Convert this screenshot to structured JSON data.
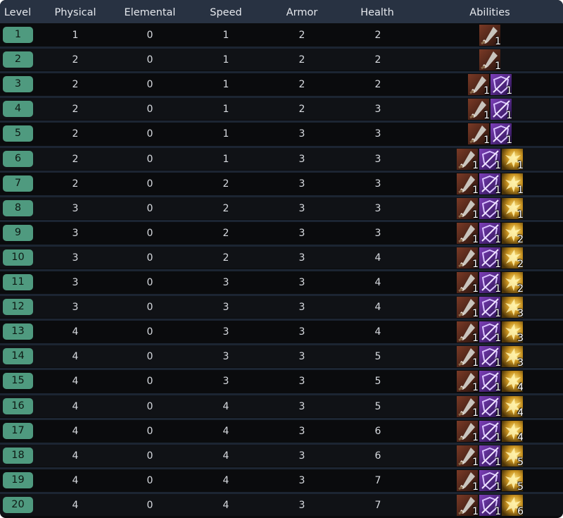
{
  "headers": {
    "level": "Level",
    "physical": "Physical",
    "elemental": "Elemental",
    "speed": "Speed",
    "armor": "Armor",
    "health": "Health",
    "abilities": "Abilities"
  },
  "ability_icons": [
    "blade-strike-icon",
    "arcane-shield-icon",
    "golden-burst-icon"
  ],
  "colors": {
    "level_badge": "#4f9a7f",
    "header_bg": "#283242",
    "ability_1": "#5a2e20",
    "ability_2": "#5b2a8a",
    "ability_3": "#b88a1a"
  },
  "rows": [
    {
      "level": "1",
      "physical": "1",
      "elemental": "0",
      "speed": "1",
      "armor": "2",
      "health": "2",
      "abilities": [
        "1"
      ]
    },
    {
      "level": "2",
      "physical": "2",
      "elemental": "0",
      "speed": "1",
      "armor": "2",
      "health": "2",
      "abilities": [
        "1"
      ]
    },
    {
      "level": "3",
      "physical": "2",
      "elemental": "0",
      "speed": "1",
      "armor": "2",
      "health": "2",
      "abilities": [
        "1",
        "1"
      ]
    },
    {
      "level": "4",
      "physical": "2",
      "elemental": "0",
      "speed": "1",
      "armor": "2",
      "health": "3",
      "abilities": [
        "1",
        "1"
      ]
    },
    {
      "level": "5",
      "physical": "2",
      "elemental": "0",
      "speed": "1",
      "armor": "3",
      "health": "3",
      "abilities": [
        "1",
        "1"
      ]
    },
    {
      "level": "6",
      "physical": "2",
      "elemental": "0",
      "speed": "1",
      "armor": "3",
      "health": "3",
      "abilities": [
        "1",
        "1",
        "1"
      ]
    },
    {
      "level": "7",
      "physical": "2",
      "elemental": "0",
      "speed": "2",
      "armor": "3",
      "health": "3",
      "abilities": [
        "1",
        "1",
        "1"
      ]
    },
    {
      "level": "8",
      "physical": "3",
      "elemental": "0",
      "speed": "2",
      "armor": "3",
      "health": "3",
      "abilities": [
        "1",
        "1",
        "1"
      ]
    },
    {
      "level": "9",
      "physical": "3",
      "elemental": "0",
      "speed": "2",
      "armor": "3",
      "health": "3",
      "abilities": [
        "1",
        "1",
        "2"
      ]
    },
    {
      "level": "10",
      "physical": "3",
      "elemental": "0",
      "speed": "2",
      "armor": "3",
      "health": "4",
      "abilities": [
        "1",
        "1",
        "2"
      ]
    },
    {
      "level": "11",
      "physical": "3",
      "elemental": "0",
      "speed": "3",
      "armor": "3",
      "health": "4",
      "abilities": [
        "1",
        "1",
        "2"
      ]
    },
    {
      "level": "12",
      "physical": "3",
      "elemental": "0",
      "speed": "3",
      "armor": "3",
      "health": "4",
      "abilities": [
        "1",
        "1",
        "3"
      ]
    },
    {
      "level": "13",
      "physical": "4",
      "elemental": "0",
      "speed": "3",
      "armor": "3",
      "health": "4",
      "abilities": [
        "1",
        "1",
        "3"
      ]
    },
    {
      "level": "14",
      "physical": "4",
      "elemental": "0",
      "speed": "3",
      "armor": "3",
      "health": "5",
      "abilities": [
        "1",
        "1",
        "3"
      ]
    },
    {
      "level": "15",
      "physical": "4",
      "elemental": "0",
      "speed": "3",
      "armor": "3",
      "health": "5",
      "abilities": [
        "1",
        "1",
        "4"
      ]
    },
    {
      "level": "16",
      "physical": "4",
      "elemental": "0",
      "speed": "4",
      "armor": "3",
      "health": "5",
      "abilities": [
        "1",
        "1",
        "4"
      ]
    },
    {
      "level": "17",
      "physical": "4",
      "elemental": "0",
      "speed": "4",
      "armor": "3",
      "health": "6",
      "abilities": [
        "1",
        "1",
        "4"
      ]
    },
    {
      "level": "18",
      "physical": "4",
      "elemental": "0",
      "speed": "4",
      "armor": "3",
      "health": "6",
      "abilities": [
        "1",
        "1",
        "5"
      ]
    },
    {
      "level": "19",
      "physical": "4",
      "elemental": "0",
      "speed": "4",
      "armor": "3",
      "health": "7",
      "abilities": [
        "1",
        "1",
        "5"
      ]
    },
    {
      "level": "20",
      "physical": "4",
      "elemental": "0",
      "speed": "4",
      "armor": "3",
      "health": "7",
      "abilities": [
        "1",
        "1",
        "6"
      ]
    }
  ]
}
